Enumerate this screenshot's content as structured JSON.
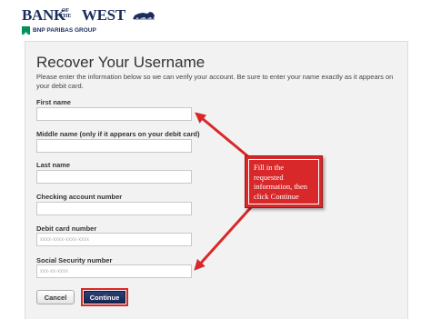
{
  "header": {
    "logo_text": "BANK of the WEST",
    "logo_word_bank": "BANK",
    "logo_word_of_the": "OF THE",
    "logo_word_west": "WEST",
    "logo_subtitle": "BNP PARIBAS GROUP"
  },
  "form": {
    "title": "Recover Your Username",
    "intro": "Please enter the information below so we can verify your account. Be sure to enter your name exactly as it appears on your debit card.",
    "fields": [
      {
        "label": "First name",
        "value": "",
        "placeholder": ""
      },
      {
        "label": "Middle name (only if it appears on your debit card)",
        "value": "",
        "placeholder": ""
      },
      {
        "label": "Last name",
        "value": "",
        "placeholder": ""
      },
      {
        "label": "Checking account number",
        "value": "",
        "placeholder": ""
      },
      {
        "label": "Debit card number",
        "value": "",
        "placeholder": "xxxx-xxxx-xxxx-xxxx"
      },
      {
        "label": "Social Security number",
        "value": "",
        "placeholder": "xxx-xx-xxxx"
      }
    ],
    "cancel_label": "Cancel",
    "continue_label": "Continue"
  },
  "annotation": {
    "callout_text": "Fill in the requested information, then click Continue",
    "color": "#d8282a"
  },
  "colors": {
    "brand_navy": "#1b2d5c",
    "bnp_green": "#00915a",
    "panel_bg": "#f2f2f2"
  }
}
